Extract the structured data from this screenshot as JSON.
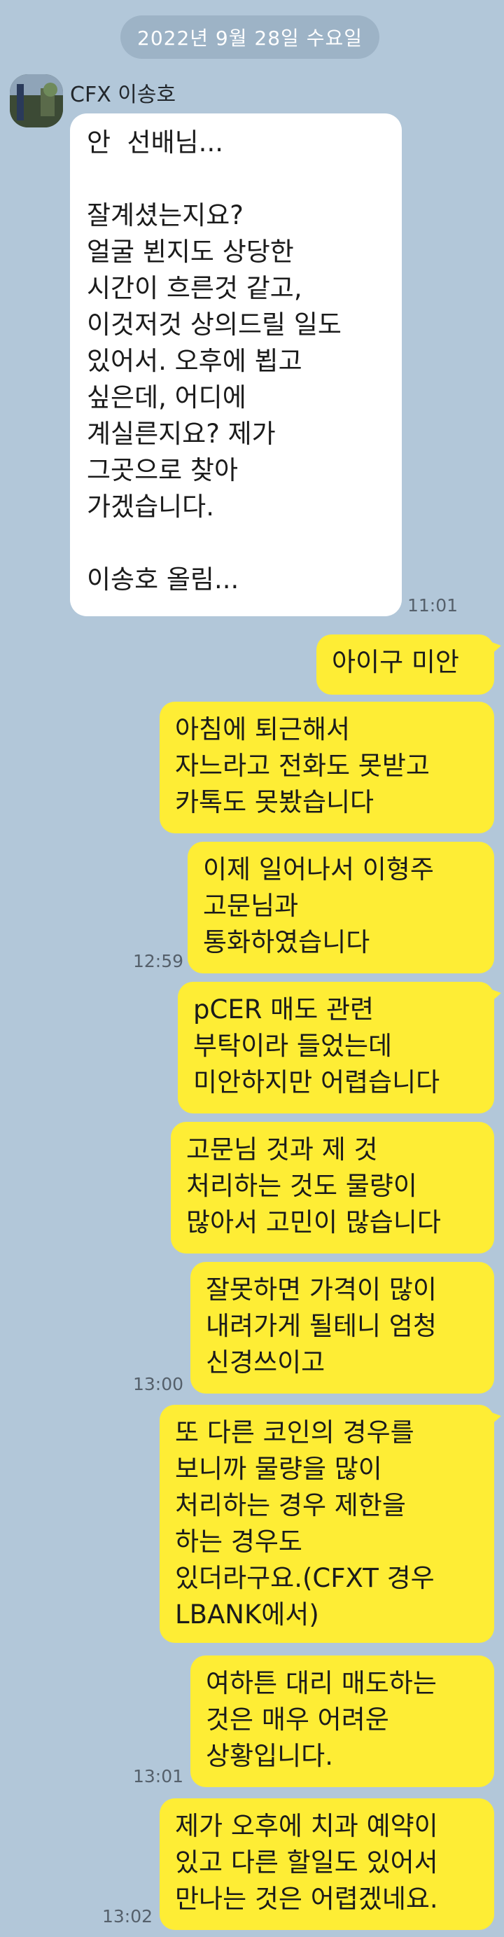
{
  "date_divider": "2022년 9월 28일 수요일",
  "sender_name": "CFX 이송호",
  "incoming": {
    "text": "안  선배님...\n\n잘계셨는지요?\n얼굴 뵌지도 상당한\n시간이 흐른것 같고,\n이것저것 상의드릴 일도\n있어서. 오후에 뵙고\n싶은데, 어디에\n계실른지요? 제가\n그곳으로 찾아\n가겠습니다.\n\n이송호 올림...",
    "time": "11:01"
  },
  "outgoing": [
    {
      "text": "아이구 미안",
      "time": ""
    },
    {
      "text": "아침에 퇴근해서\n자느라고 전화도 못받고\n카톡도 못봤습니다",
      "time": ""
    },
    {
      "text": "이제 일어나서 이형주\n고문님과\n통화하였습니다",
      "time": "12:59"
    },
    {
      "text": "pCER 매도 관련\n부탁이라 들었는데\n미안하지만 어렵습니다",
      "time": ""
    },
    {
      "text": "고문님 것과 제 것\n처리하는 것도 물량이\n많아서 고민이 많습니다",
      "time": ""
    },
    {
      "text": "잘못하면 가격이 많이\n내려가게 될테니 엄청\n신경쓰이고",
      "time": "13:00"
    },
    {
      "text": "또 다른 코인의 경우를\n보니까 물량을 많이\n처리하는 경우 제한을\n하는 경우도\n있더라구요.(CFXT 경우\nLBANK에서)",
      "time": ""
    },
    {
      "text": "여하튼 대리 매도하는\n것은 매우 어려운\n상황입니다.",
      "time": "13:01"
    },
    {
      "text": "제가 오후에 치과 예약이\n있고 다른 할일도 있어서\n만나는 것은 어렵겠네요.",
      "time": "13:02"
    }
  ]
}
